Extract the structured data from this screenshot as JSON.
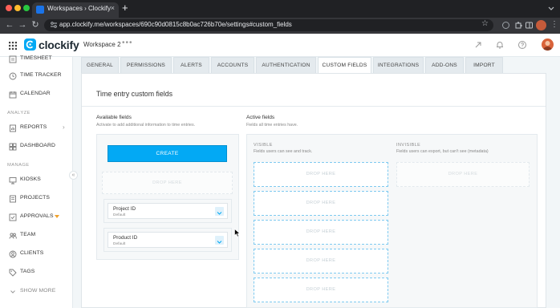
{
  "browser": {
    "tab_title": "Workspaces › Clockify",
    "tab_close": "×",
    "new_tab": "+",
    "url": "app.clockify.me/workspaces/690c90d0815c8b0ac726b70e/settings#custom_fields",
    "back": "←",
    "forward": "→",
    "reload": "↻",
    "star": "☆",
    "menu": "⋮",
    "icons": [
      "extension-icon",
      "puzzle-icon",
      "sidebar-icon",
      "profile-avatar"
    ]
  },
  "header": {
    "logo": "clockify",
    "workspace": "Workspace 2",
    "workspace_menu": "•••",
    "icons": [
      "grid-icon",
      "download-icon",
      "bell-icon",
      "help-icon",
      "user-avatar"
    ]
  },
  "sidebar": {
    "items_top": [
      {
        "label": "TIMESHEET",
        "icon": "timesheet-icon"
      },
      {
        "label": "TIME TRACKER",
        "icon": "clock-icon"
      },
      {
        "label": "CALENDAR",
        "icon": "calendar-icon"
      }
    ],
    "section_analyze": "ANALYZE",
    "items_analyze": [
      {
        "label": "REPORTS",
        "icon": "reports-icon",
        "chevron": "›"
      },
      {
        "label": "DASHBOARD",
        "icon": "dashboard-icon"
      }
    ],
    "section_manage": "MANAGE",
    "items_manage": [
      {
        "label": "KIOSKS",
        "icon": "kiosk-icon"
      },
      {
        "label": "PROJECTS",
        "icon": "projects-icon"
      },
      {
        "label": "APPROVALS",
        "icon": "approvals-icon"
      },
      {
        "label": "TEAM",
        "icon": "team-icon"
      },
      {
        "label": "CLIENTS",
        "icon": "clients-icon"
      },
      {
        "label": "TAGS",
        "icon": "tag-icon"
      }
    ],
    "show_more": "SHOW MORE",
    "collapse": "«",
    "badge_color": "#f0a12b"
  },
  "tabs": [
    {
      "label": "GENERAL"
    },
    {
      "label": "PERMISSIONS"
    },
    {
      "label": "ALERTS"
    },
    {
      "label": "ACCOUNTS"
    },
    {
      "label": "AUTHENTICATION"
    },
    {
      "label": "CUSTOM FIELDS",
      "active": true
    },
    {
      "label": "INTEGRATIONS"
    },
    {
      "label": "ADD-ONS"
    },
    {
      "label": "IMPORT"
    }
  ],
  "content": {
    "title": "Time entry custom fields",
    "available": {
      "title": "Available fields",
      "subtitle": "Activate to add additional information to time entries.",
      "create_label": "CREATE",
      "drop_label": "DROP HERE",
      "fields": [
        {
          "name": "Project ID",
          "default": "Default"
        },
        {
          "name": "Product ID",
          "default": "Default"
        }
      ]
    },
    "active": {
      "title": "Active fields",
      "subtitle": "Fields all time entries have.",
      "visible": {
        "title": "VISIBLE",
        "subtitle": "Fields users can see and track.",
        "drop_zones": [
          "DROP HERE",
          "DROP HERE",
          "DROP HERE",
          "DROP HERE",
          "DROP HERE"
        ]
      },
      "invisible": {
        "title": "INVISIBLE",
        "subtitle": "Fields users can export, but can't see (metadata)",
        "drop_zones": [
          "DROP HERE"
        ]
      }
    }
  },
  "colors": {
    "accent": "#03a9f4",
    "background": "#f2f6f8",
    "chrome": "#202124"
  }
}
